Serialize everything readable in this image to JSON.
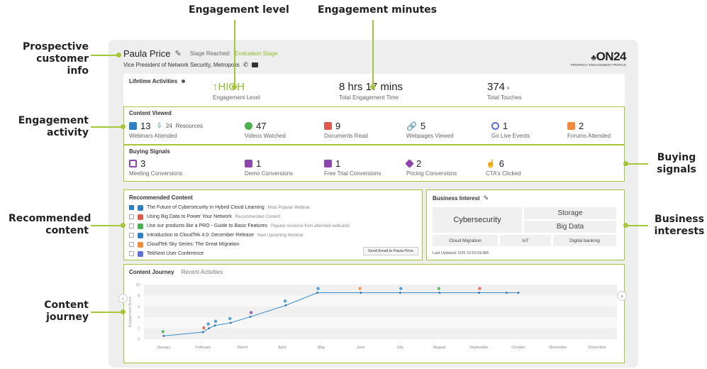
{
  "callouts": {
    "engagement_level": "Engagement level",
    "engagement_minutes": "Engagement minutes",
    "prospective_customer_info": [
      "Prospective",
      "customer info"
    ],
    "engagement_activity": [
      "Engagement",
      "activity"
    ],
    "recommended_content": [
      "Recommended",
      "content"
    ],
    "content_journey": [
      "Content",
      "journey"
    ],
    "buying_signals": [
      "Buying",
      "signals"
    ],
    "business_interests": [
      "Business",
      "interests"
    ]
  },
  "profile": {
    "name": "Paula Price",
    "stage_label": "Stage Reached:",
    "stage_value": "Evaluation Stage",
    "title": "Vice President of Network Security, Metropolis",
    "brand": "ON24",
    "brand_sub": "PROSPECT ENGAGEMENT PROFILE"
  },
  "lifetime": {
    "title": "Lifetime Activities",
    "level_value": "HIGH",
    "level_label": "Engagement Level",
    "time_value": "8 hrs 17 mins",
    "time_label": "Total Engagement Time",
    "touches_value": "374",
    "touches_label": "Total Touches"
  },
  "content_viewed": {
    "title": "Content Viewed",
    "webinars_value": "13",
    "resources_value": "24",
    "resources_label": "Resources",
    "webinars_label": "Webinars Attended",
    "videos_value": "47",
    "videos_label": "Videos Watched",
    "documents_value": "9",
    "documents_label": "Documents Read",
    "webpages_value": "5",
    "webpages_label": "Webpages Viewed",
    "live_value": "1",
    "live_label": "Go Live Events",
    "forums_value": "2",
    "forums_label": "Forums Attended"
  },
  "buying_signals": {
    "title": "Buying Signals",
    "meeting_value": "3",
    "meeting_label": "Meeting Conversions",
    "demo_value": "1",
    "demo_label": "Demo Conversions",
    "trial_value": "1",
    "trial_label": "Free Trial Conversions",
    "pricing_value": "2",
    "pricing_label": "Pricing Conversions",
    "cta_value": "6",
    "cta_label": "CTA's Clicked"
  },
  "recommended": {
    "title": "Recommended Content",
    "items": [
      {
        "text": "The Future of Cybersecurity in Hybrid Cloud Learning",
        "tag": "Most Popular Webinar",
        "color": "#2f80c0",
        "checked": true
      },
      {
        "text": "Using Big Data to Power Your Network",
        "tag": "Recommended Content",
        "color": "#e05a4f",
        "checked": false
      },
      {
        "text": "Use our products like a PRO - Guide to Basic Features",
        "tag": "Popular resource from attended webcasts",
        "color": "#4caf50",
        "checked": false
      },
      {
        "text": "Introduction to CloudTek 4.0: December Release",
        "tag": "Next Upcoming Webinar",
        "color": "#2f80c0",
        "checked": false
      },
      {
        "text": "CloudTek Sky Series: The Great Migration",
        "tag": "",
        "color": "#f08a3c",
        "checked": false
      },
      {
        "text": "TekNext User Conference",
        "tag": "",
        "color": "#5b6fd6",
        "checked": false
      }
    ],
    "email_button": "Send Email to Paula Price"
  },
  "business": {
    "title": "Business Interest",
    "cybersecurity": "Cybersecurity",
    "storage": "Storage",
    "big_data": "Big Data",
    "cloud_migration": "Cloud Migration",
    "iot": "IoT",
    "digital_banking": "Digital banking",
    "updated": "Last Updated: 6/25 10:52:09 AM"
  },
  "journey": {
    "tab_active": "Content Journey",
    "tab_other": "Recent Activities",
    "ylabel": "Engagement Score"
  },
  "chart_data": {
    "type": "line",
    "categories": [
      "January",
      "February",
      "March",
      "April",
      "May",
      "June",
      "July",
      "August",
      "September",
      "October",
      "November",
      "December"
    ],
    "ylabel": "Engagement Score",
    "yticks": [
      "10",
      "8",
      "6",
      "4",
      "2",
      "0"
    ],
    "ylim": [
      0,
      10
    ],
    "series": [
      {
        "x": [
          0.0,
          1.0,
          1.15,
          1.3,
          1.7,
          2.2,
          3.1,
          3.9,
          5.0,
          6.0,
          7.0,
          8.0,
          8.7,
          9.0
        ],
        "y": [
          0.6,
          1.3,
          2.0,
          2.5,
          3.0,
          4.1,
          6.2,
          8.5,
          8.5,
          8.5,
          8.5,
          8.5,
          8.5,
          8.5
        ]
      }
    ],
    "grid": true
  },
  "colors": {
    "accent": "#a6c63a",
    "stage": "#8dbb2b",
    "blue": "#2f80c0"
  }
}
